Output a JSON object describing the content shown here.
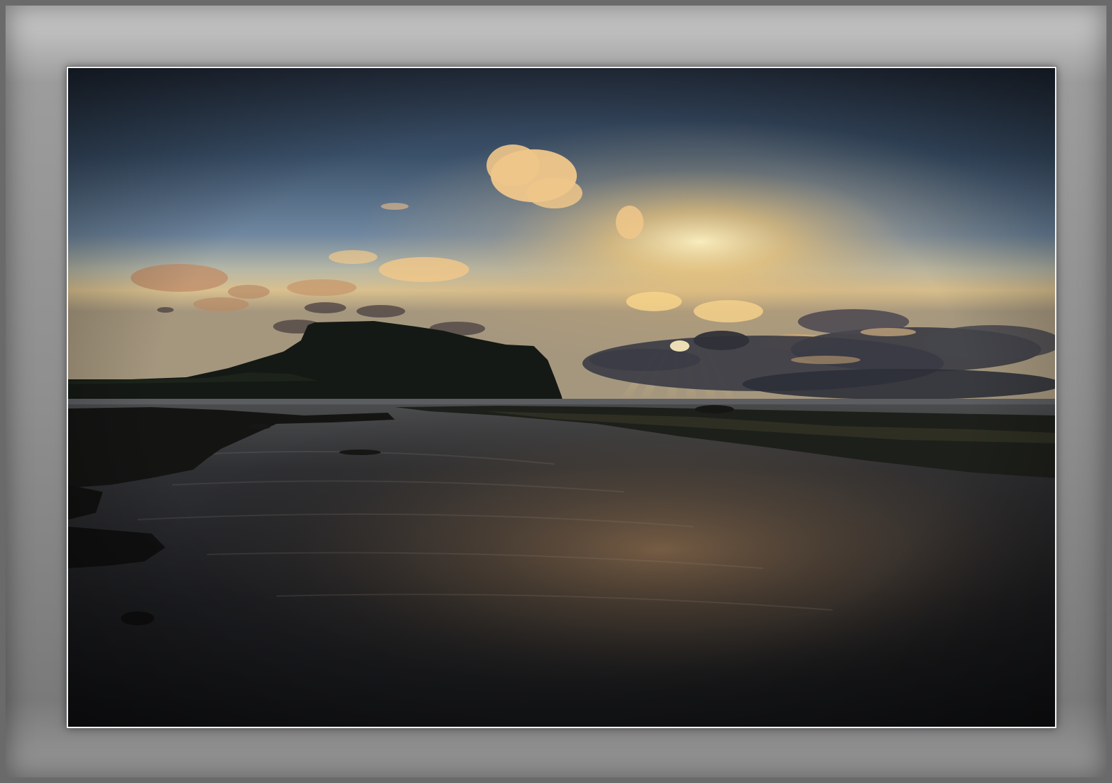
{
  "scene": {
    "subject": "sunset-over-coastal-headland",
    "colors": {
      "sky_top": "#2a3446",
      "sky_mid": "#4e6a86",
      "horizon_glow": "#f2c774",
      "cloud_lit": "#f6cf8c",
      "cloud_dark": "#3a3a40",
      "headland": "#141814",
      "water_dark": "#17191c",
      "water_reflection": "#8a6a46",
      "frame_gray": "#9a9a9a"
    }
  }
}
